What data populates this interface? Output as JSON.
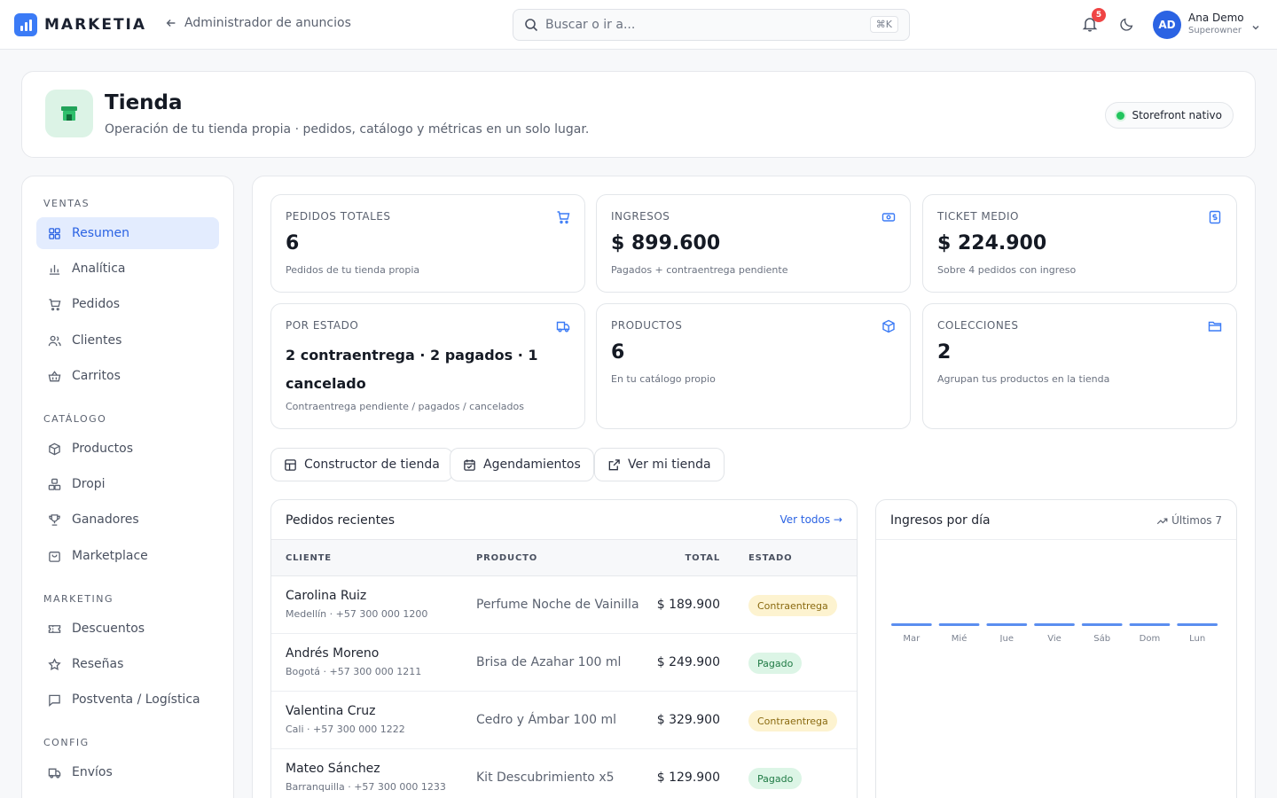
{
  "app": {
    "brand": "MARKETIA",
    "back_label": "Administrador de anuncios"
  },
  "search": {
    "placeholder": "Buscar o ir a...",
    "shortcut": "⌘K"
  },
  "notifications": {
    "count": "5"
  },
  "user": {
    "initials": "AD",
    "name": "Ana Demo",
    "role": "Superowner"
  },
  "header": {
    "title": "Tienda",
    "subtitle": "Operación de tu tienda propia · pedidos, catálogo y métricas en un solo lugar.",
    "pill": "Storefront nativo"
  },
  "sidebar": {
    "sections": [
      {
        "label": "VENTAS",
        "items": [
          "Resumen",
          "Analítica",
          "Pedidos",
          "Clientes",
          "Carritos"
        ]
      },
      {
        "label": "CATÁLOGO",
        "items": [
          "Productos",
          "Dropi",
          "Ganadores",
          "Marketplace"
        ]
      },
      {
        "label": "MARKETING",
        "items": [
          "Descuentos",
          "Reseñas",
          "Postventa / Logística"
        ]
      },
      {
        "label": "CONFIG",
        "items": [
          "Envíos"
        ]
      }
    ],
    "active": "Resumen"
  },
  "stats": [
    {
      "label": "PEDIDOS TOTALES",
      "value": "6",
      "desc": "Pedidos de tu tienda propia",
      "icon": "cart-icon"
    },
    {
      "label": "INGRESOS",
      "value": "$ 899.600",
      "desc": "Pagados + contraentrega pendiente",
      "icon": "cash-icon"
    },
    {
      "label": "TICKET MEDIO",
      "value": "$ 224.900",
      "desc": "Sobre 4 pedidos con ingreso",
      "icon": "receipt-icon"
    },
    {
      "label": "POR ESTADO",
      "value": "2 contraentrega · 2 pagados · 1 cancelado",
      "desc": "Contraentrega pendiente / pagados / cancelados",
      "icon": "truck-icon"
    },
    {
      "label": "PRODUCTOS",
      "value": "6",
      "desc": "En tu catálogo propio",
      "icon": "box-icon"
    },
    {
      "label": "COLECCIONES",
      "value": "2",
      "desc": "Agrupan tus productos en la tienda",
      "icon": "folder-icon"
    }
  ],
  "actions": {
    "builder": "Constructor de tienda",
    "schedule": "Agendamientos",
    "view_store": "Ver mi tienda"
  },
  "orders": {
    "title": "Pedidos recientes",
    "view_all": "Ver todos →",
    "columns": {
      "client": "CLIENTE",
      "product": "PRODUCTO",
      "total": "TOTAL",
      "status": "ESTADO"
    },
    "rows": [
      {
        "name": "Carolina Ruiz",
        "sub": "Medellín · +57 300 000 1200",
        "product": "Perfume Noche de Vainilla",
        "total": "$ 189.900",
        "status": "Contraentrega",
        "kind": "cod"
      },
      {
        "name": "Andrés Moreno",
        "sub": "Bogotá · +57 300 000 1211",
        "product": "Brisa de Azahar 100 ml",
        "total": "$ 249.900",
        "status": "Pagado",
        "kind": "paid"
      },
      {
        "name": "Valentina Cruz",
        "sub": "Cali · +57 300 000 1222",
        "product": "Cedro y Ámbar 100 ml",
        "total": "$ 329.900",
        "status": "Contraentrega",
        "kind": "cod"
      },
      {
        "name": "Mateo Sánchez",
        "sub": "Barranquilla · +57 300 000 1233",
        "product": "Kit Descubrimiento x5",
        "total": "$ 129.900",
        "status": "Pagado",
        "kind": "paid"
      }
    ]
  },
  "revenue": {
    "title": "Ingresos por día",
    "range": "Últimos 7",
    "days": [
      "Mar",
      "Mié",
      "Jue",
      "Vie",
      "Sáb",
      "Dom",
      "Lun"
    ],
    "bar_color": "#5b8ef0"
  },
  "colors": {
    "accent": "#2b63e3",
    "brand": "#3b7bf6",
    "success": "#22c55e",
    "danger": "#ef4444"
  }
}
